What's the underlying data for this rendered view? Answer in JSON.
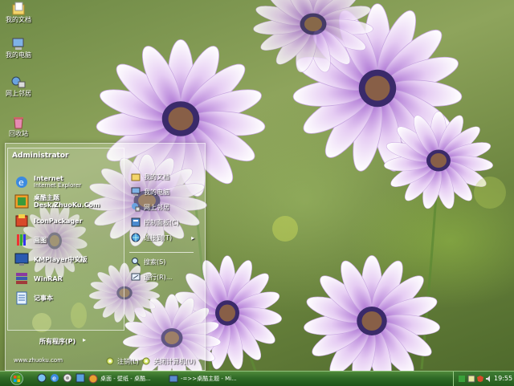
{
  "desktop_icons": [
    {
      "name": "my-documents",
      "label": "我的文档"
    },
    {
      "name": "my-computer",
      "label": "我的电脑"
    },
    {
      "name": "network-places",
      "label": "网上邻居"
    },
    {
      "name": "recycle-bin",
      "label": "回收站"
    }
  ],
  "start_menu": {
    "user": "Administrator",
    "programs": [
      {
        "title": "Internet",
        "subtitle": "Internet Explorer"
      },
      {
        "title": "桌酷主题Desk.ZhuoKu.Com",
        "subtitle": ""
      },
      {
        "title": "IconPackager",
        "subtitle": ""
      },
      {
        "title": "画图",
        "subtitle": ""
      },
      {
        "title": "KMPlayer中文版",
        "subtitle": ""
      },
      {
        "title": "WinRAR",
        "subtitle": ""
      },
      {
        "title": "记事本",
        "subtitle": ""
      }
    ],
    "all_programs": "所有程序(P)",
    "places": [
      {
        "label": "我的文档"
      },
      {
        "label": "我的电脑"
      },
      {
        "label": "网上邻居"
      },
      {
        "label": "控制面板(C)"
      },
      {
        "label": "连接到(T)"
      },
      {
        "label": "搜索(S)"
      },
      {
        "label": "运行(R)..."
      }
    ],
    "url": "www.zhuoku.com",
    "logoff": "注销(L)",
    "shutdown": "关闭计算机(U)"
  },
  "taskbar": {
    "tasks": [
      {
        "label": "桌面 - 壁纸 - 桌酷..."
      },
      {
        "label": "-=>>桌酷主题 - Mi..."
      }
    ],
    "clock": "19:55"
  },
  "colors": {
    "taskbar": "#2f6a26",
    "accent": "#6fb14a"
  }
}
